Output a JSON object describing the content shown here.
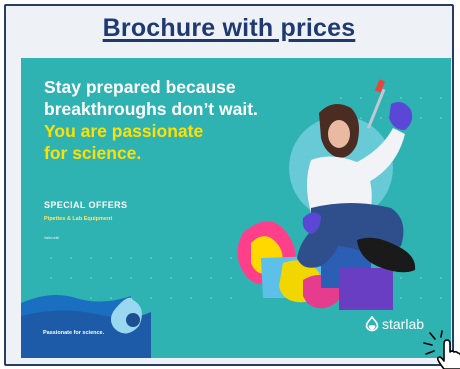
{
  "card": {
    "heading": "Brochure with prices "
  },
  "banner": {
    "headline_line1": "Stay prepared because",
    "headline_line2": "breakthroughs don’t wait.",
    "headline_line3": "You are passionate",
    "headline_line4": "for science.",
    "offers_title": "SPECIAL OFFERS",
    "offers_subtitle": "Pipettes & Lab Equipment",
    "validity": "Valid until",
    "tagline": "Passionate for science.",
    "logo_text": "starlab"
  },
  "colors": {
    "heading": "#1f3a70",
    "banner_bg": "#2fb3b2",
    "highlight": "#ffe000",
    "border": "#2b3c63"
  }
}
